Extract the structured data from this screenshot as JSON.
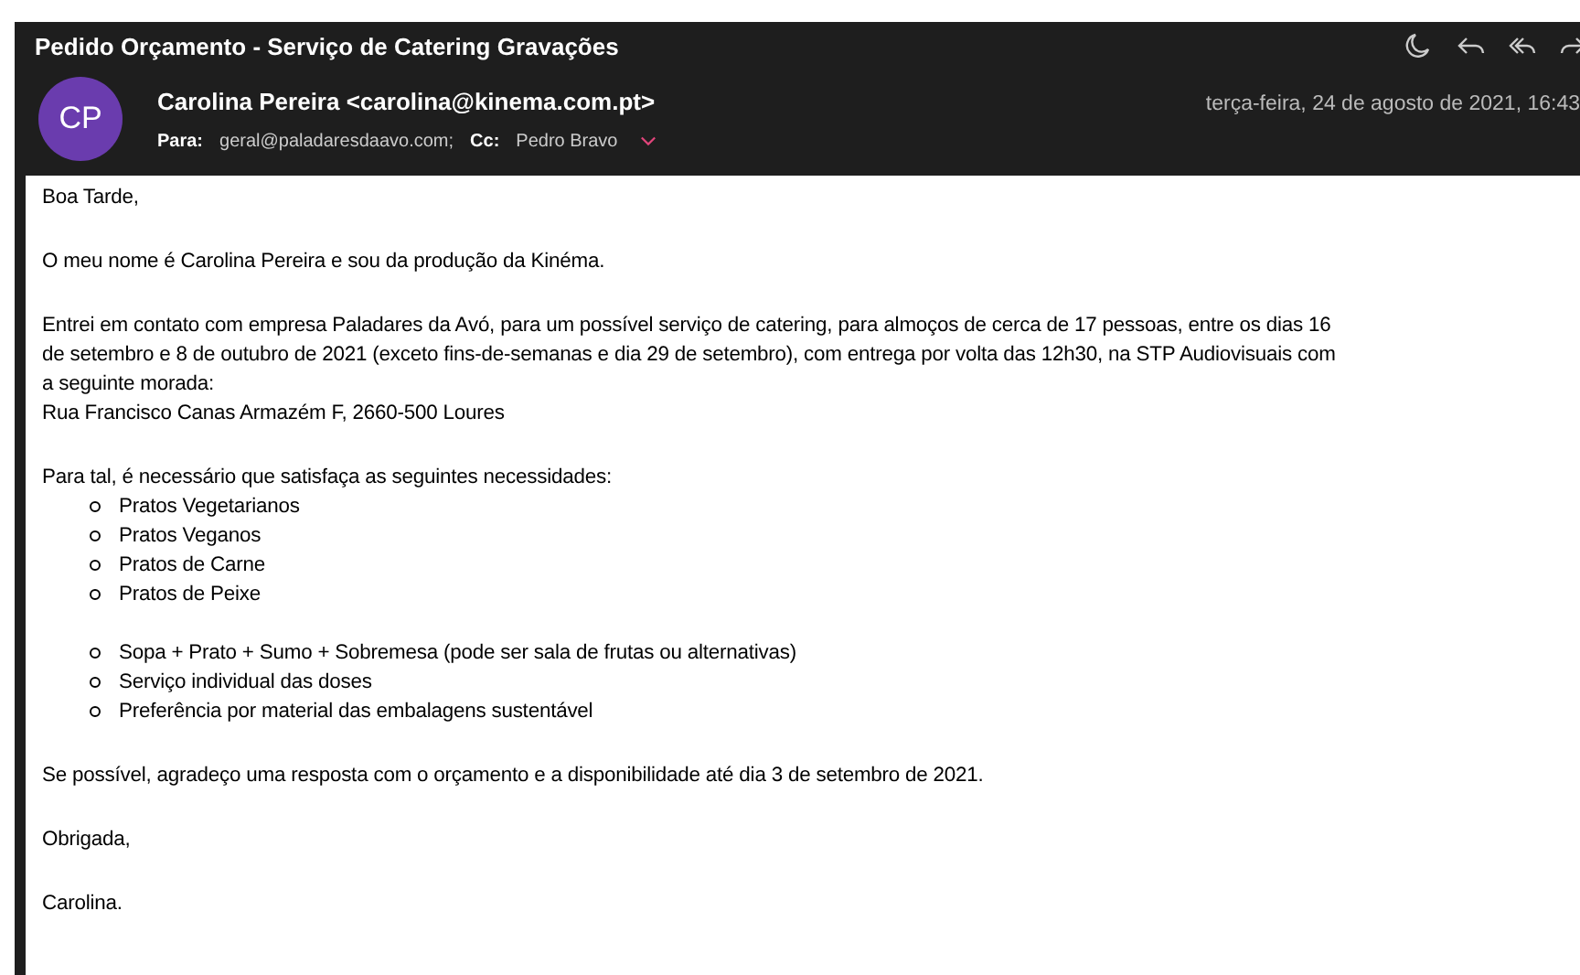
{
  "message": {
    "subject": "Pedido Orçamento - Serviço de Catering Gravações",
    "sender": "Carolina Pereira <carolina@kinema.com.pt>",
    "avatar_initials": "CP",
    "date": "terça-feira, 24 de agosto de 2021, 16:43",
    "to_label": "Para:",
    "to": "geral@paladaresdaavo.com;",
    "cc_label": "Cc:",
    "cc": "Pedro Bravo"
  },
  "body": [
    {
      "kind": "paragraph",
      "lines": [
        "Boa Tarde,"
      ]
    },
    {
      "kind": "paragraph",
      "lines": [
        "O meu nome é Carolina Pereira e sou da produção da Kinéma."
      ]
    },
    {
      "kind": "paragraph",
      "lines": [
        "Entrei em contato com empresa Paladares da Avó, para um possível serviço de catering, para almoços de cerca de 17 pessoas, entre os dias 16",
        "de setembro e 8 de outubro de 2021 (exceto fins-de-semanas e dia 29 de setembro), com entrega por volta das 12h30, na STP Audiovisuais com",
        "a seguinte morada:",
        "Rua Francisco Canas Armazém F, 2660-500 Loures"
      ]
    },
    {
      "kind": "list",
      "intro": "Para tal, é necessário que satisfaça as seguintes necessidades:",
      "groups": [
        [
          "Pratos Vegetarianos",
          "Pratos Veganos",
          "Pratos de Carne",
          "Pratos de Peixe"
        ],
        [
          "Sopa + Prato + Sumo + Sobremesa (pode ser sala de frutas ou alternativas)",
          "Serviço individual das doses",
          "Preferência por material das embalagens sustentável"
        ]
      ]
    },
    {
      "kind": "paragraph",
      "lines": [
        "Se possível, agradeço uma resposta com o orçamento e a disponibilidade até dia 3 de setembro de 2021."
      ]
    },
    {
      "kind": "paragraph",
      "lines": [
        "Obrigada,"
      ]
    },
    {
      "kind": "paragraph",
      "lines": [
        "Carolina."
      ]
    }
  ]
}
